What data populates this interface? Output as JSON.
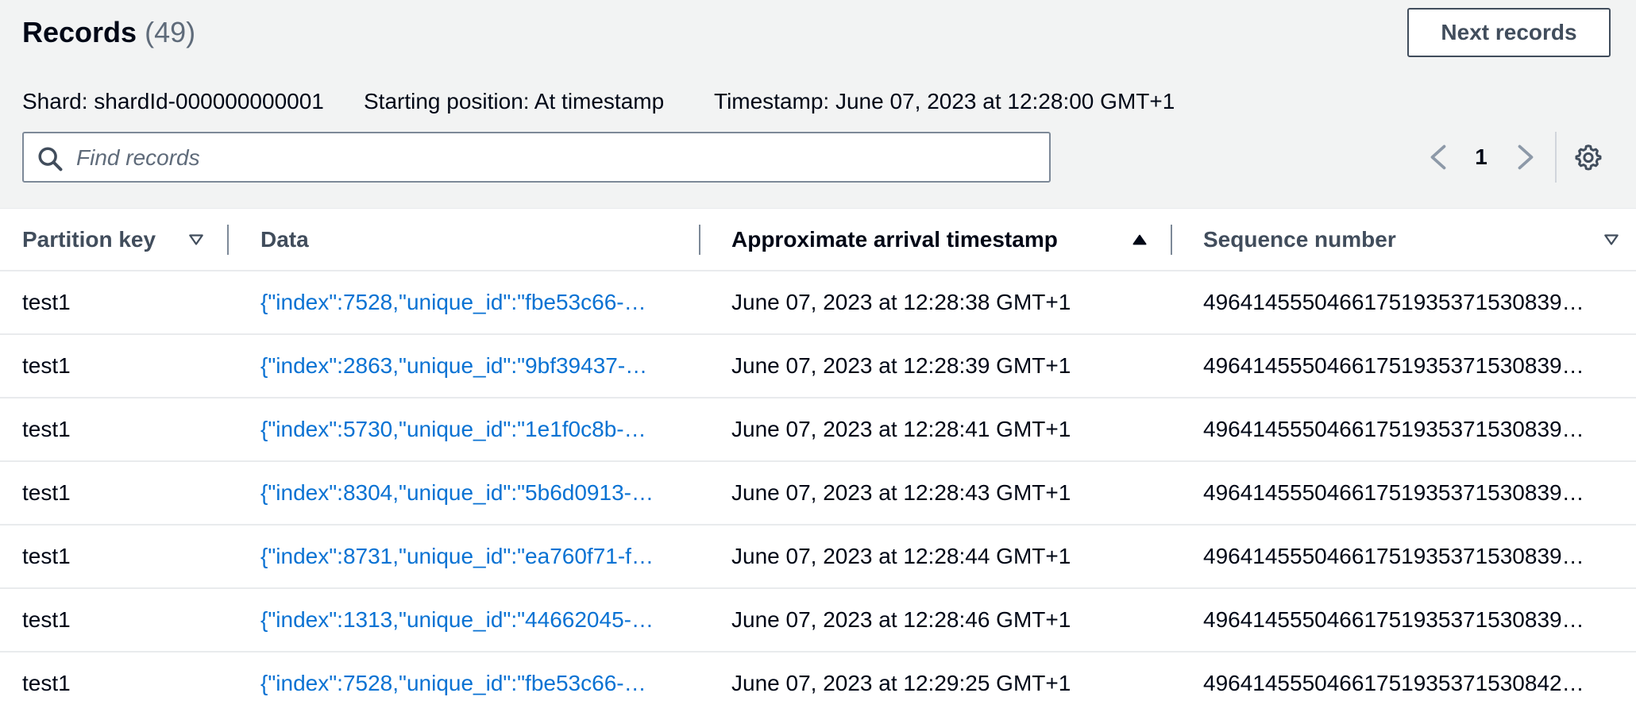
{
  "header": {
    "title": "Records",
    "count": "(49)",
    "next_button": "Next records",
    "shard": "Shard: shardId-000000000001",
    "starting_position": "Starting position: At timestamp",
    "timestamp": "Timestamp: June 07, 2023 at 12:28:00 GMT+1"
  },
  "search": {
    "placeholder": "Find records",
    "value": ""
  },
  "pagination": {
    "current_page": "1"
  },
  "table": {
    "columns": [
      {
        "label": "Partition key",
        "sort": "none"
      },
      {
        "label": "Data",
        "sort": "none"
      },
      {
        "label": "Approximate arrival timestamp",
        "sort": "ascending"
      },
      {
        "label": "Sequence number",
        "sort": "none"
      }
    ],
    "rows": [
      {
        "partition_key": "test1",
        "data": "{\"index\":7528,\"unique_id\":\"fbe53c66-…",
        "timestamp": "June 07, 2023 at 12:28:38 GMT+1",
        "sequence": "4964145550466175193537153083​9…"
      },
      {
        "partition_key": "test1",
        "data": "{\"index\":2863,\"unique_id\":\"9bf39437-…",
        "timestamp": "June 07, 2023 at 12:28:39 GMT+1",
        "sequence": "4964145550466175193537153083​9…"
      },
      {
        "partition_key": "test1",
        "data": "{\"index\":5730,\"unique_id\":\"1e1f0c8b-…",
        "timestamp": "June 07, 2023 at 12:28:41 GMT+1",
        "sequence": "4964145550466175193537153083​9…"
      },
      {
        "partition_key": "test1",
        "data": "{\"index\":8304,\"unique_id\":\"5b6d0913-…",
        "timestamp": "June 07, 2023 at 12:28:43 GMT+1",
        "sequence": "4964145550466175193537153083​9…"
      },
      {
        "partition_key": "test1",
        "data": "{\"index\":8731,\"unique_id\":\"ea760f71-f…",
        "timestamp": "June 07, 2023 at 12:28:44 GMT+1",
        "sequence": "4964145550466175193537153083​9…"
      },
      {
        "partition_key": "test1",
        "data": "{\"index\":1313,\"unique_id\":\"44662045-…",
        "timestamp": "June 07, 2023 at 12:28:46 GMT+1",
        "sequence": "4964145550466175193537153083​9…"
      },
      {
        "partition_key": "test1",
        "data": "{\"index\":7528,\"unique_id\":\"fbe53c66-…",
        "timestamp": "June 07, 2023 at 12:29:25 GMT+1",
        "sequence": "4964145550466175193537153084​2…"
      }
    ]
  },
  "colors": {
    "link": "#0972d3",
    "text": "#000716",
    "header_bg": "#f2f3f3"
  },
  "icons": {
    "search": "search-icon",
    "prev": "chevron-left-icon",
    "next": "chevron-right-icon",
    "settings": "gear-icon",
    "sort_none": "caret-down-outline-icon",
    "sort_asc": "caret-up-filled-icon"
  }
}
